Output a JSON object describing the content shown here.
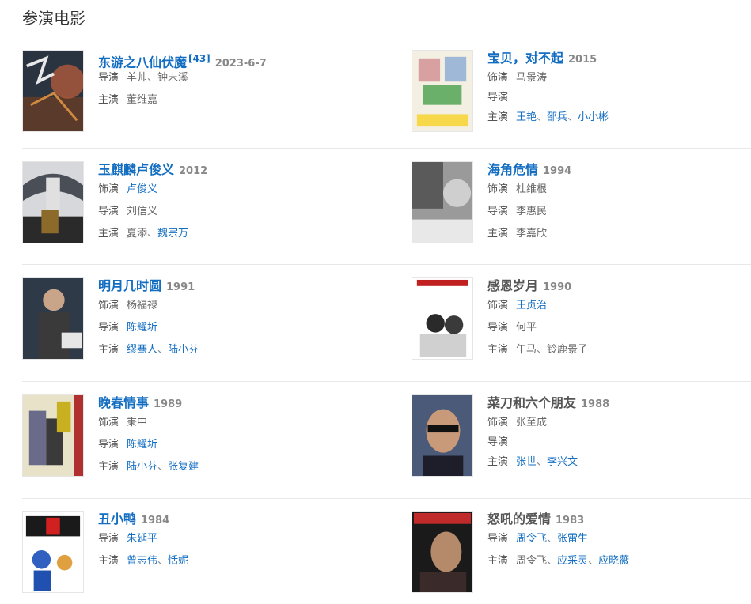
{
  "section_title": "参演电影",
  "movies": [
    {
      "title": "东游之八仙伏魔",
      "title_link": true,
      "cite": "[43]",
      "year": "2023-6-7",
      "roles": [
        {
          "label": "导演",
          "names": [
            {
              "text": "羊帅",
              "link": false
            },
            {
              "text": "钟末溪",
              "link": false
            }
          ]
        },
        {
          "label": "主演",
          "names": [
            {
              "text": "董维嘉",
              "link": false
            }
          ]
        }
      ]
    },
    {
      "title": "宝贝，对不起",
      "title_link": true,
      "year": "2015",
      "roles": [
        {
          "label": "饰演",
          "names": [
            {
              "text": "马景涛",
              "link": false
            }
          ]
        },
        {
          "label": "导演",
          "names": []
        },
        {
          "label": "主演",
          "names": [
            {
              "text": "王艳",
              "link": true
            },
            {
              "text": "邵兵",
              "link": true
            },
            {
              "text": "小小彬",
              "link": true
            }
          ]
        }
      ]
    },
    {
      "title": "玉麒麟卢俊义",
      "title_link": true,
      "year": "2012",
      "roles": [
        {
          "label": "饰演",
          "names": [
            {
              "text": "卢俊义",
              "link": true
            }
          ]
        },
        {
          "label": "导演",
          "names": [
            {
              "text": "刘信义",
              "link": false
            }
          ]
        },
        {
          "label": "主演",
          "names": [
            {
              "text": "夏添",
              "link": false
            },
            {
              "text": "魏宗万",
              "link": true
            }
          ]
        }
      ]
    },
    {
      "title": "海角危情",
      "title_link": true,
      "year": "1994",
      "roles": [
        {
          "label": "饰演",
          "names": [
            {
              "text": "杜维根",
              "link": false
            }
          ]
        },
        {
          "label": "导演",
          "names": [
            {
              "text": "李惠民",
              "link": false
            }
          ]
        },
        {
          "label": "主演",
          "names": [
            {
              "text": "李嘉欣",
              "link": false
            }
          ]
        }
      ]
    },
    {
      "title": "明月几时圆",
      "title_link": true,
      "year": "1991",
      "roles": [
        {
          "label": "饰演",
          "names": [
            {
              "text": "杨福禄",
              "link": false
            }
          ]
        },
        {
          "label": "导演",
          "names": [
            {
              "text": "陈耀圻",
              "link": true
            }
          ]
        },
        {
          "label": "主演",
          "names": [
            {
              "text": "缪骞人",
              "link": true
            },
            {
              "text": "陆小芬",
              "link": true
            }
          ]
        }
      ]
    },
    {
      "title": "感恩岁月",
      "title_link": false,
      "year": "1990",
      "roles": [
        {
          "label": "饰演",
          "names": [
            {
              "text": "王贞治",
              "link": true
            }
          ]
        },
        {
          "label": "导演",
          "names": [
            {
              "text": "何平",
              "link": false
            }
          ]
        },
        {
          "label": "主演",
          "names": [
            {
              "text": "午马",
              "link": false
            },
            {
              "text": "铃鹿景子",
              "link": false
            }
          ]
        }
      ]
    },
    {
      "title": "晚春情事",
      "title_link": true,
      "year": "1989",
      "roles": [
        {
          "label": "饰演",
          "names": [
            {
              "text": "秉中",
              "link": false
            }
          ]
        },
        {
          "label": "导演",
          "names": [
            {
              "text": "陈耀圻",
              "link": true
            }
          ]
        },
        {
          "label": "主演",
          "names": [
            {
              "text": "陆小芬",
              "link": true
            },
            {
              "text": "张复建",
              "link": true
            }
          ]
        }
      ]
    },
    {
      "title": "菜刀和六个朋友",
      "title_link": false,
      "year": "1988",
      "roles": [
        {
          "label": "饰演",
          "names": [
            {
              "text": "张至成",
              "link": false
            }
          ]
        },
        {
          "label": "导演",
          "names": []
        },
        {
          "label": "主演",
          "names": [
            {
              "text": "张世",
              "link": true
            },
            {
              "text": "李兴文",
              "link": true
            }
          ]
        }
      ]
    },
    {
      "title": "丑小鸭",
      "title_link": true,
      "year": "1984",
      "roles": [
        {
          "label": "导演",
          "names": [
            {
              "text": "朱延平",
              "link": true
            }
          ]
        },
        {
          "label": "主演",
          "names": [
            {
              "text": "曾志伟",
              "link": true
            },
            {
              "text": "恬妮",
              "link": true
            }
          ]
        }
      ]
    },
    {
      "title": "怒吼的爱情",
      "title_link": false,
      "year": "1983",
      "roles": [
        {
          "label": "导演",
          "names": [
            {
              "text": "周令飞",
              "link": true
            },
            {
              "text": "张雷生",
              "link": true
            }
          ]
        },
        {
          "label": "主演",
          "names": [
            {
              "text": "周令飞",
              "link": false
            },
            {
              "text": "应采灵",
              "link": true
            },
            {
              "text": "应晓薇",
              "link": true
            }
          ]
        }
      ]
    }
  ]
}
